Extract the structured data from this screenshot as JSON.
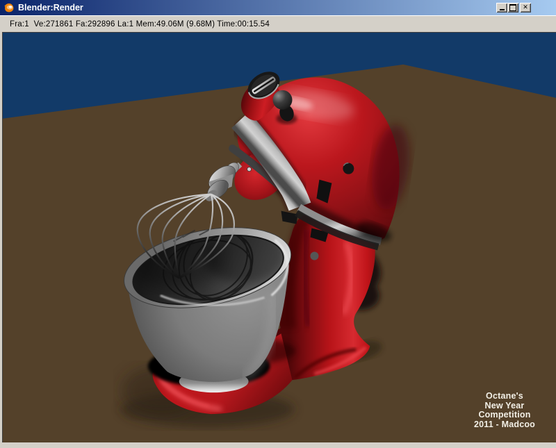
{
  "window": {
    "title": "Blender:Render",
    "close_glyph": "✕",
    "icons": {
      "app": "blender-logo-icon",
      "minimize": "minimize-icon",
      "maximize": "maximize-icon",
      "close": "close-icon"
    }
  },
  "statusbar": {
    "text": "Fra:1  Ve:271861 Fa:292896 La:1 Mem:49.06M (9.68M) Time:00:15.54"
  },
  "render": {
    "scene": "red stand mixer with wire whisk and dark bowl on brown floor",
    "watermark": {
      "line1": "Octane's",
      "line2": "New Year",
      "line3": "Competition",
      "line4": "2011 - Madcoo"
    }
  },
  "colors": {
    "titlebar_left": "#0a246a",
    "titlebar_right": "#a6caf0",
    "window_chrome": "#d4d0c8",
    "sky": "#123a68",
    "floor": "#54412a",
    "mixer_red": "#c8161d",
    "bowl_gray": "#6f6f6f",
    "watermark_text": "#f2efe6"
  }
}
